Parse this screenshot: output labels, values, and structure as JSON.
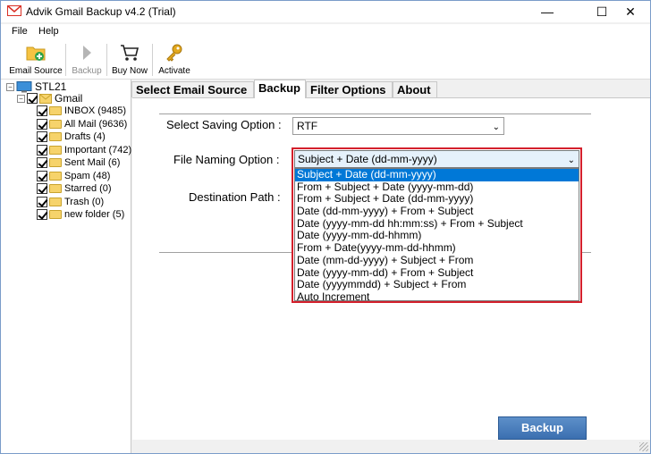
{
  "window": {
    "title": "Advik Gmail Backup v4.2 (Trial)",
    "controls": {
      "minimize": "—",
      "maximize": "☐",
      "close": "✕"
    }
  },
  "menu": {
    "file": "File",
    "help": "Help"
  },
  "toolbar": {
    "email_source": "Email Source",
    "backup": "Backup",
    "buy_now": "Buy Now",
    "activate": "Activate"
  },
  "tree": {
    "root": "STL21",
    "account": "Gmail",
    "folders": [
      "INBOX (9485)",
      "All Mail (9636)",
      "Drafts (4)",
      "Important (742)",
      "Sent Mail (6)",
      "Spam (48)",
      "Starred (0)",
      "Trash (0)",
      "new folder (5)"
    ]
  },
  "tabs": [
    "Select Email Source",
    "Backup",
    "Filter Options",
    "About"
  ],
  "form": {
    "saving_label": "Select Saving Option  :",
    "saving_value": "RTF",
    "naming_label": "File Naming Option  :",
    "naming_value": "Subject + Date (dd-mm-yyyy)",
    "destination_label": "Destination Path  :",
    "naming_options": [
      "Subject + Date (dd-mm-yyyy)",
      "From + Subject + Date (yyyy-mm-dd)",
      "From + Subject + Date (dd-mm-yyyy)",
      "Date (dd-mm-yyyy) + From + Subject",
      "Date (yyyy-mm-dd hh:mm:ss) + From + Subject",
      "Date (yyyy-mm-dd-hhmm)",
      "From + Date(yyyy-mm-dd-hhmm)",
      "Date (mm-dd-yyyy) + Subject + From",
      "Date (yyyy-mm-dd) + From + Subject",
      "Date (yyyymmdd) + Subject + From",
      "Auto Increment"
    ]
  },
  "backup_button": "Backup",
  "colors": {
    "highlight": "#d4202c",
    "selection": "#0078d7",
    "button": "#3b6fb0"
  }
}
